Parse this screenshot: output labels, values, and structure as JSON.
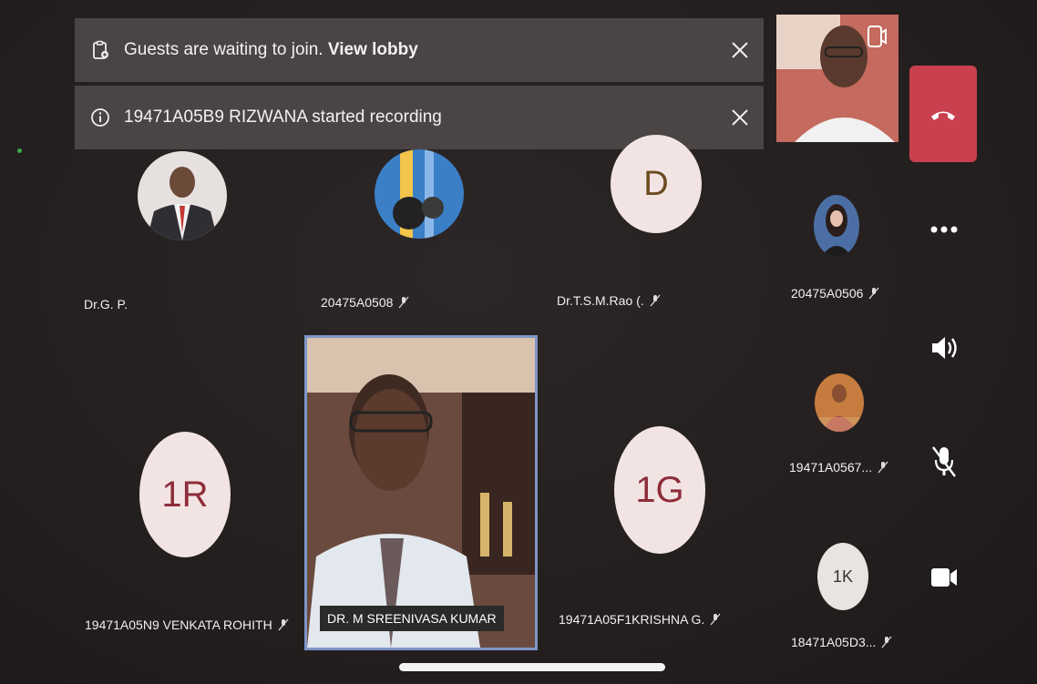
{
  "notifications": [
    {
      "text": "Guests are waiting to join. ",
      "link": "View lobby",
      "icon": "lobby-clipboard-icon"
    },
    {
      "text": "19471A05B9 RIZWANA started recording",
      "icon": "info-icon"
    }
  ],
  "participants": {
    "p1": {
      "name": "Dr.G. P."
    },
    "p2": {
      "name": "20475A0508"
    },
    "p3": {
      "initial": "D",
      "name": "Dr.T.S.M.Rao (."
    },
    "p4": {
      "name": "20475A0506"
    },
    "p5": {
      "initial": "1R",
      "name": "19471A05N9 VENKATA ROHITH"
    },
    "p6": {
      "name": "DR. M SREENIVASA KUMAR"
    },
    "p7": {
      "initial": "1G",
      "name": "19471A05F1KRISHNA G."
    },
    "p8": {
      "name": "19471A0567..."
    },
    "p9": {
      "initial": "1K",
      "name": "18471A05D3..."
    }
  },
  "controls": [
    "end-call",
    "more-options",
    "speaker",
    "microphone-muted",
    "camera"
  ],
  "colors": {
    "end_call": "#c9404e",
    "active_border": "#7e96c8",
    "initials_bg": "#f3e4e4",
    "initials_fg": "#8e2d3a"
  }
}
